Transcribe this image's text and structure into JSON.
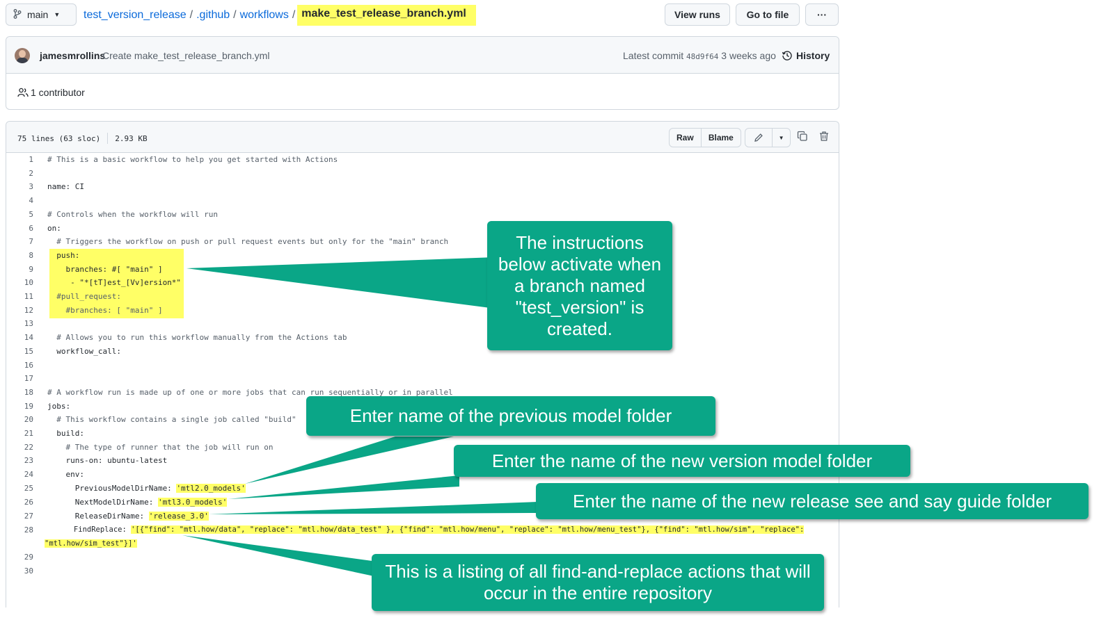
{
  "header": {
    "branch": "main",
    "breadcrumb": [
      {
        "label": "test_version_release"
      },
      {
        "label": ".github"
      },
      {
        "label": "workflows"
      }
    ],
    "separator": "/",
    "file_name": "make_test_release_branch.yml",
    "view_runs": "View runs",
    "go_to_file": "Go to file",
    "more": "···"
  },
  "commit": {
    "author": "jamesmrollins",
    "message": "Create make_test_release_branch.yml",
    "latest_label": "Latest commit",
    "sha": "48d9f64",
    "age": "3 weeks ago",
    "history": "History",
    "contributors": "1 contributor"
  },
  "file": {
    "lines_info": "75 lines (63 sloc)",
    "size": "2.93 KB",
    "raw": "Raw",
    "blame": "Blame"
  },
  "code_lines": [
    {
      "n": "1",
      "t": "# This is a basic workflow to help you get started with Actions"
    },
    {
      "n": "2",
      "t": ""
    },
    {
      "n": "3",
      "t": "name: CI"
    },
    {
      "n": "4",
      "t": ""
    },
    {
      "n": "5",
      "t": "# Controls when the workflow will run"
    },
    {
      "n": "6",
      "t": "on:"
    },
    {
      "n": "7",
      "t": "  # Triggers the workflow on push or pull request events but only for the \"main\" branch"
    },
    {
      "n": "8",
      "t": "  push:"
    },
    {
      "n": "9",
      "t": "    branches: #[ \"main\" ]"
    },
    {
      "n": "10",
      "t": "     - \"*[tT]est_[Vv]ersion*\""
    },
    {
      "n": "11",
      "t": "  #pull_request:"
    },
    {
      "n": "12",
      "t": "    #branches: [ \"main\" ]"
    },
    {
      "n": "13",
      "t": ""
    },
    {
      "n": "14",
      "t": "  # Allows you to run this workflow manually from the Actions tab"
    },
    {
      "n": "15",
      "t": "  workflow_call:"
    },
    {
      "n": "16",
      "t": ""
    },
    {
      "n": "17",
      "t": ""
    },
    {
      "n": "18",
      "t": "# A workflow run is made up of one or more jobs that can run sequentially or in parallel"
    },
    {
      "n": "19",
      "t": "jobs:"
    },
    {
      "n": "20",
      "t": "  # This workflow contains a single job called \"build\""
    },
    {
      "n": "21",
      "t": "  build:"
    },
    {
      "n": "22",
      "t": "    # The type of runner that the job will run on"
    },
    {
      "n": "23",
      "t": "    runs-on: ubuntu-latest"
    },
    {
      "n": "24",
      "t": "    env:"
    }
  ],
  "env_lines": {
    "l25": {
      "n": "25",
      "key": "      PreviousModelDirName: ",
      "val": "'mtl2.0_models'"
    },
    "l26": {
      "n": "26",
      "key": "      NextModelDirName: ",
      "val": "'mtl3.0_models'"
    },
    "l27": {
      "n": "27",
      "key": "      ReleaseDirName: ",
      "val": "'release_3.0'"
    },
    "l28": {
      "n": "28",
      "key": "      FindReplace: ",
      "val": "'[{\"find\": \"mtl.how/data\", \"replace\": \"mtl.how/data_test\" }, {\"find\": \"mtl.how/menu\", \"replace\": \"mtl.how/menu_test\"}, {\"find\": \"mtl.how/sim\", \"replace\":",
      "val2": "\"mtl.how/sim_test\"}]'"
    },
    "l29": {
      "n": "29"
    },
    "l30": {
      "n": "30"
    }
  },
  "callouts": {
    "c1": "The instructions below activate when a branch named \"test_version\" is created.",
    "c2": "Enter name of the previous model folder",
    "c3": "Enter the name of the new version model folder",
    "c4": "Enter the name of the new release see and say guide folder",
    "c5": "This is a listing of all find-and-replace actions that will occur in the entire repository"
  },
  "colors": {
    "callout": "#0aa687",
    "highlight": "#ffff66",
    "link": "#0969da"
  }
}
